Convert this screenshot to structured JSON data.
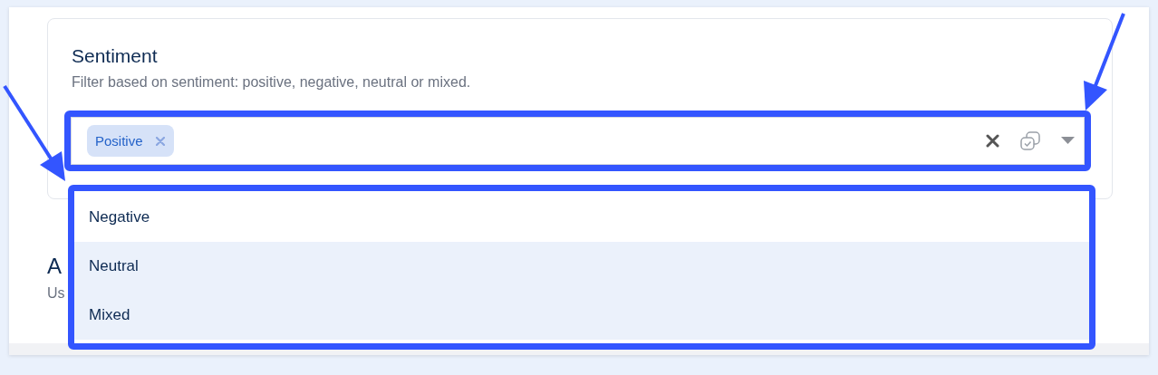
{
  "section": {
    "title": "Sentiment",
    "description": "Filter based on sentiment: positive, negative, neutral or mixed."
  },
  "select": {
    "chips": [
      {
        "label": "Positive"
      }
    ]
  },
  "dropdown": {
    "options": [
      {
        "label": "Negative",
        "highlighted": false
      },
      {
        "label": "Neutral",
        "highlighted": true
      },
      {
        "label": "Mixed",
        "highlighted": true
      }
    ]
  },
  "next_section": {
    "title": "A",
    "description": "Us"
  }
}
